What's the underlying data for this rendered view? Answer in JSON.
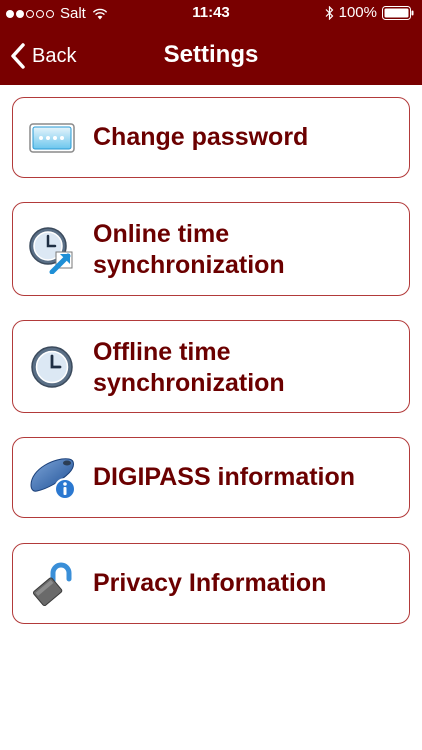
{
  "status_bar": {
    "carrier": "Salt",
    "time": "11:43",
    "battery": "100%"
  },
  "nav": {
    "back_label": "Back",
    "title": "Settings"
  },
  "menu": [
    {
      "label": "Change password",
      "icon": "password-field-icon"
    },
    {
      "label": "Online time synchronization",
      "icon": "online-clock-sync-icon"
    },
    {
      "label": "Offline time synchronization",
      "icon": "clock-icon"
    },
    {
      "label": "DIGIPASS information",
      "icon": "digipass-info-icon"
    },
    {
      "label": "Privacy Information",
      "icon": "privacy-lock-icon"
    }
  ],
  "colors": {
    "header_bg": "#790000",
    "label_text": "#6b0000",
    "card_border": "#b23a3a"
  }
}
